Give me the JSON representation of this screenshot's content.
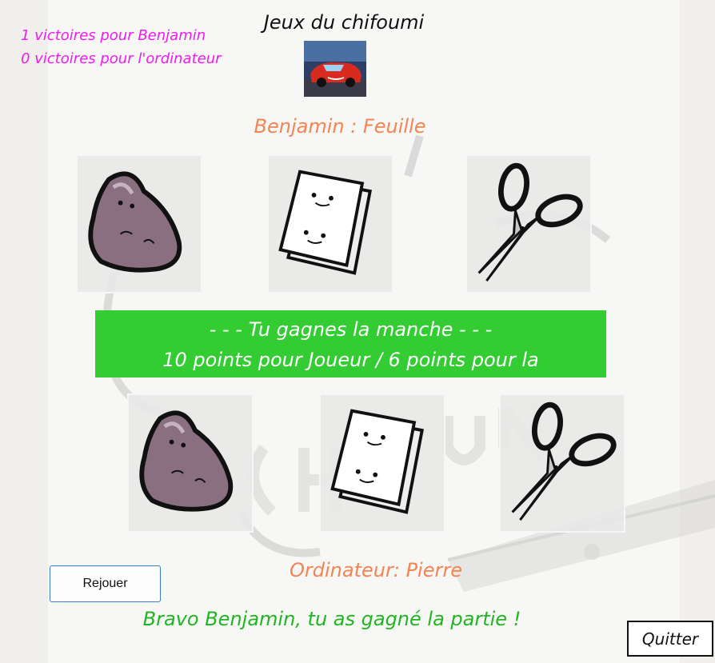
{
  "app": {
    "title": "Jeux du chifoumi"
  },
  "score": {
    "player_line": "1 victoires pour Benjamin",
    "computer_line": "0 victoires pour l'ordinateur"
  },
  "player": {
    "choice_label": "Benjamin : Feuille"
  },
  "banner": {
    "line1": "- - - Tu gagnes la manche - - -",
    "line2": "10 points pour Joueur / 6 points pour la",
    "color": "#33cc33"
  },
  "computer": {
    "choice_label": "Ordinateur: Pierre"
  },
  "result": {
    "message": "Bravo Benjamin, tu as gagné la partie !"
  },
  "buttons": {
    "replay": "Rejouer",
    "quit": "Quitter"
  },
  "colors": {
    "score": "#ee1cee",
    "choice": "#f48452",
    "result": "#21b521",
    "button_border": "#3d7bd0"
  },
  "icons": {
    "rock": "rock-icon",
    "paper": "paper-icon",
    "scissors": "scissors-icon",
    "car": "racing-car-image"
  }
}
